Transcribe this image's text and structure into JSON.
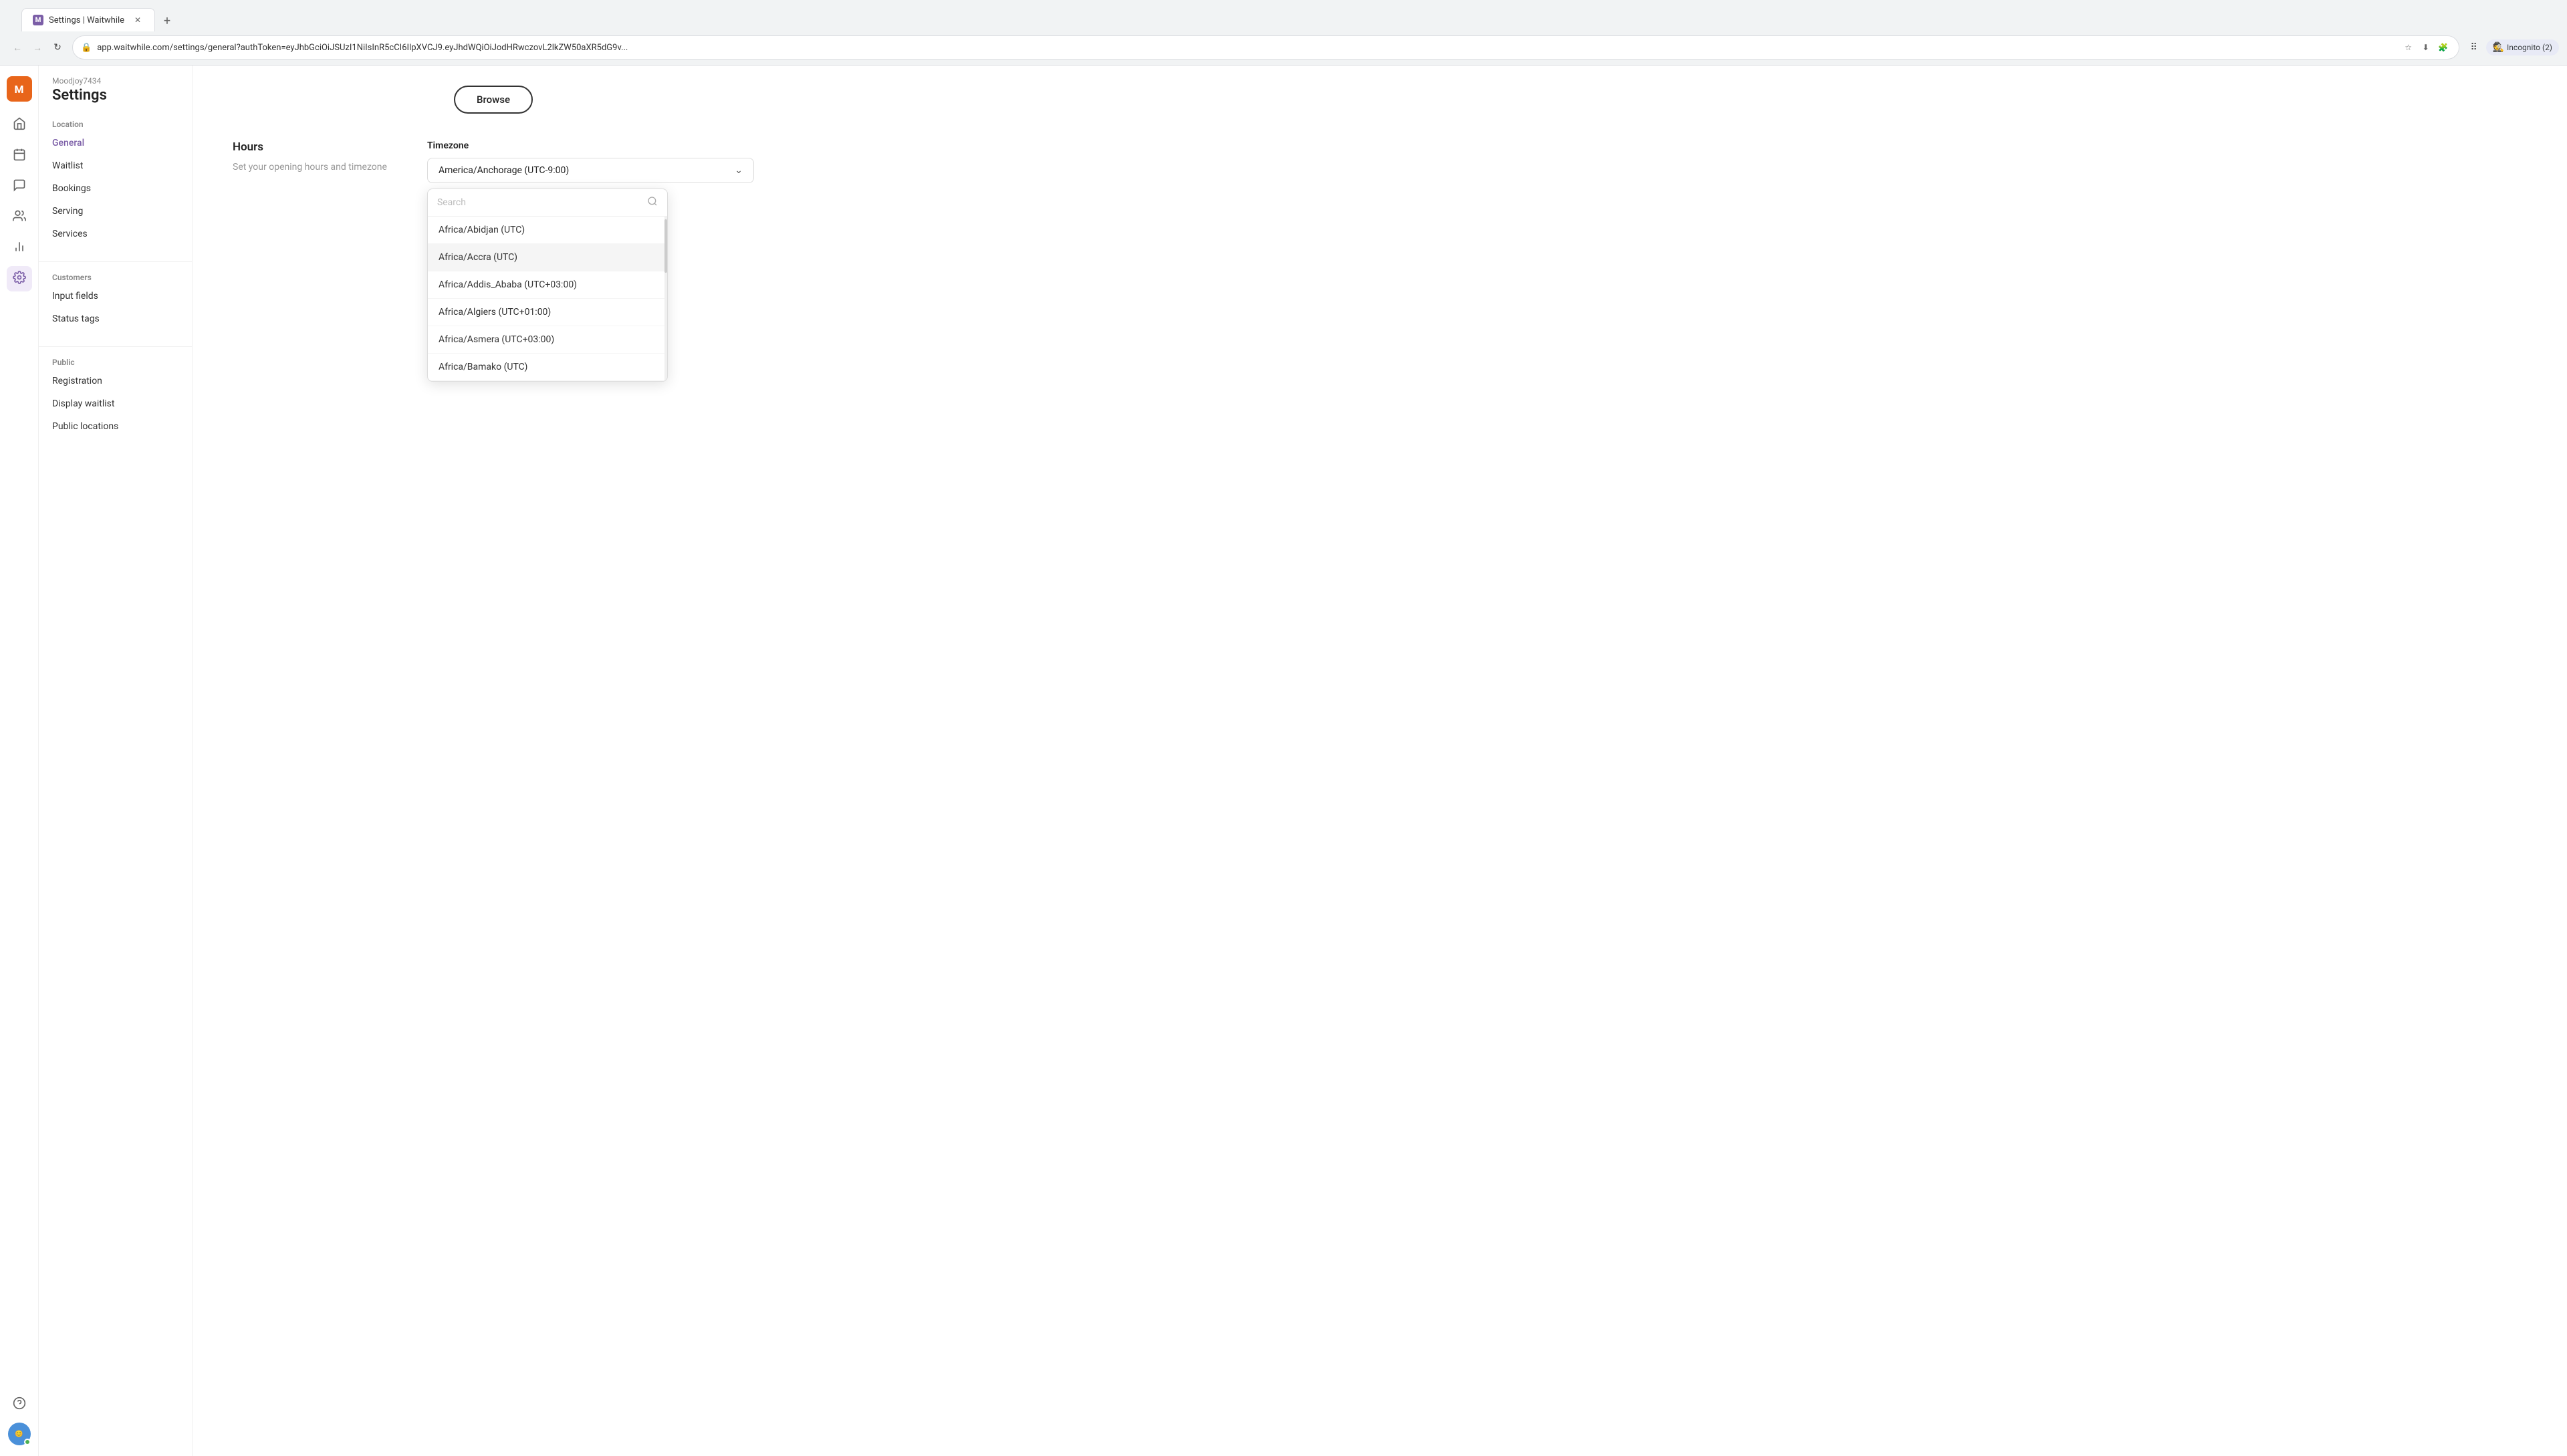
{
  "browser": {
    "tab_title": "Settings | Waitwhile",
    "favicon_letter": "M",
    "url": "app.waitwhile.com/settings/general?authToken=eyJhbGciOiJSUzI1NiIsInR5cCI6IlpXVCJ9.eyJhdWQiOiJodHRwczovL2lkZW50aXR5dG9v...",
    "incognito_label": "Incognito (2)"
  },
  "app": {
    "account": "Moodjoy7434",
    "page_title": "Settings",
    "logo_letter": "M"
  },
  "sidebar_icons": {
    "home": "⌂",
    "calendar": "▦",
    "chat": "💬",
    "users": "👥",
    "chart": "📊",
    "settings": "⚙"
  },
  "nav": {
    "location_label": "Location",
    "items": [
      {
        "id": "general",
        "label": "General",
        "active": true
      },
      {
        "id": "waitlist",
        "label": "Waitlist"
      },
      {
        "id": "bookings",
        "label": "Bookings"
      },
      {
        "id": "serving",
        "label": "Serving"
      },
      {
        "id": "services",
        "label": "Services"
      }
    ],
    "customers_label": "Customers",
    "customers_items": [
      {
        "id": "input-fields",
        "label": "Input fields"
      },
      {
        "id": "status-tags",
        "label": "Status tags"
      }
    ],
    "public_label": "Public",
    "public_items": [
      {
        "id": "registration",
        "label": "Registration"
      },
      {
        "id": "display-waitlist",
        "label": "Display waitlist"
      },
      {
        "id": "public-locations",
        "label": "Public locations"
      }
    ]
  },
  "content": {
    "browse_button": "Browse",
    "hours_title": "Hours",
    "hours_desc": "Set your opening hours and timezone",
    "timezone_label": "Timezone",
    "selected_timezone": "America/Anchorage (UTC-9:00)",
    "search_placeholder": "Search",
    "timezones": [
      "Africa/Abidjan (UTC)",
      "Africa/Accra (UTC)",
      "Africa/Addis_Ababa (UTC+03:00)",
      "Africa/Algiers (UTC+01:00)",
      "Africa/Asmera (UTC+03:00)",
      "Africa/Bamako (UTC)"
    ]
  }
}
